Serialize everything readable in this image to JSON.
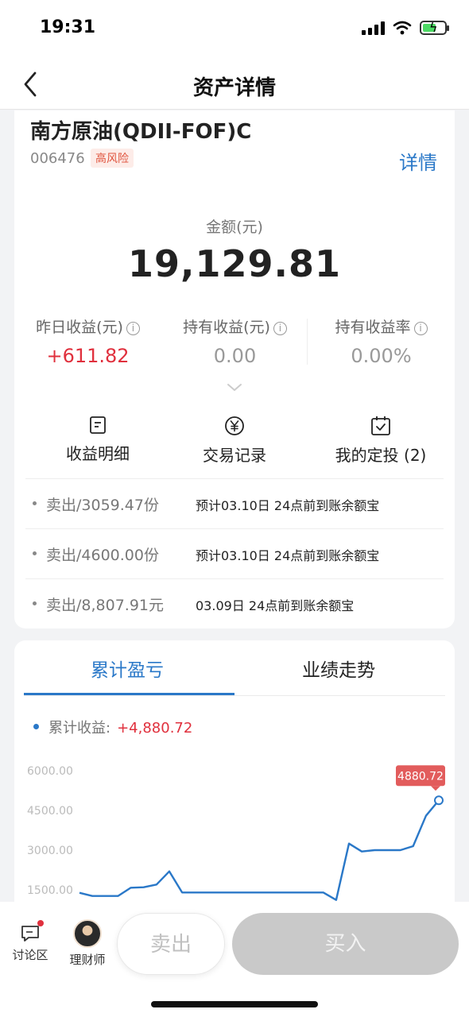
{
  "status_bar": {
    "time": "19:31"
  },
  "nav": {
    "title": "资产详情"
  },
  "fund": {
    "name": "南方原油(QDII-FOF)C",
    "code": "006476",
    "risk": "高风险",
    "detail_link": "详情"
  },
  "amount": {
    "label": "金额(元)",
    "value": "19,129.81"
  },
  "stats": [
    {
      "label": "昨日收益(元)",
      "value": "+611.82"
    },
    {
      "label": "持有收益(元)",
      "value": "0.00"
    },
    {
      "label": "持有收益率",
      "value": "0.00%"
    }
  ],
  "actions": [
    {
      "label": "收益明细",
      "icon": "document-icon"
    },
    {
      "label": "交易记录",
      "icon": "yen-circle-icon"
    },
    {
      "label": "我的定投 (2)",
      "icon": "calendar-check-icon"
    }
  ],
  "transactions": [
    {
      "left": "卖出/3059.47份",
      "right": "预计03.10日 24点前到账余额宝"
    },
    {
      "left": "卖出/4600.00份",
      "right": "预计03.10日 24点前到账余额宝"
    },
    {
      "left": "卖出/8,807.91元",
      "right": "03.09日 24点前到账余额宝"
    }
  ],
  "tabs": {
    "active": "累计盈亏",
    "inactive": "业绩走势"
  },
  "legend": {
    "label": "累计收益:",
    "value": "+4,880.72"
  },
  "chart_data": {
    "type": "line",
    "yticks": [
      "6000.00",
      "4500.00",
      "3000.00",
      "1500.00"
    ],
    "ylim": [
      1000,
      6000
    ],
    "tooltip": "4880.72",
    "series": [
      {
        "color": "#2a78c8",
        "values": [
          1390,
          1270,
          1270,
          1270,
          1580,
          1600,
          1700,
          2200,
          1400,
          1400,
          1400,
          1400,
          1400,
          1400,
          1400,
          1400,
          1400,
          1400,
          1400,
          1400,
          1120,
          3250,
          2950,
          3000,
          3000,
          3000,
          3150,
          4300,
          4880.72
        ]
      }
    ]
  },
  "bottom_bar": {
    "discuss_label": "讨论区",
    "advisor_label": "理财师",
    "sell_label": "卖出",
    "buy_label": "买入"
  },
  "colors": {
    "accent": "#2a78c8",
    "positive": "#e0303d",
    "risk_tag": "#e0553f"
  }
}
